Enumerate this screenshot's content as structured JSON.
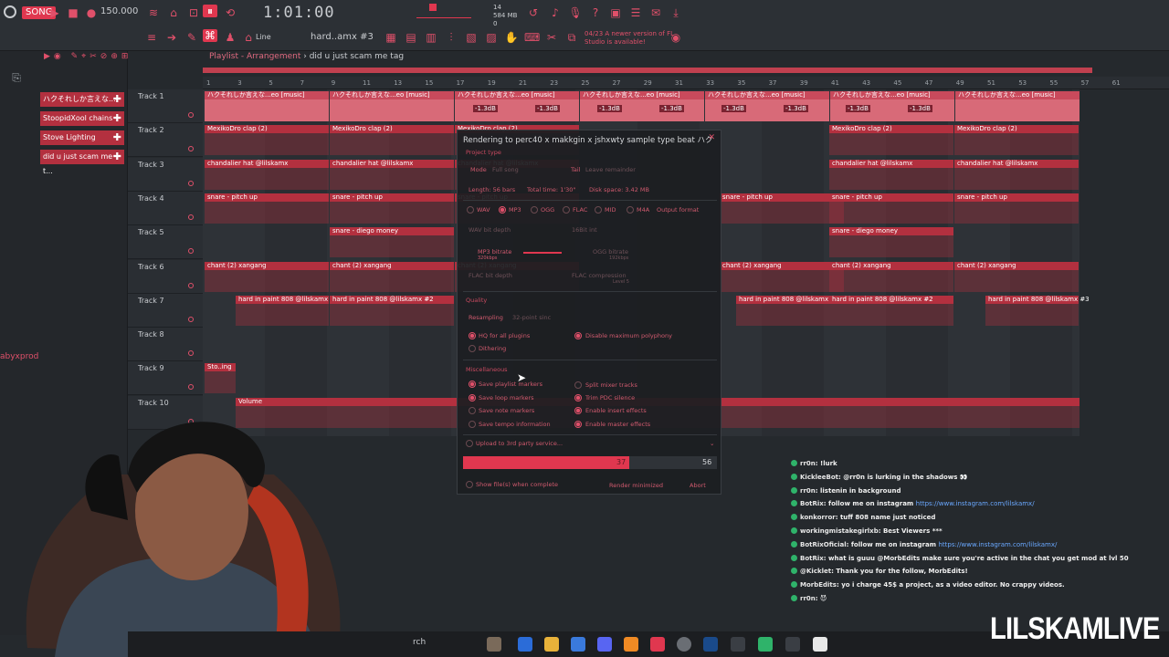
{
  "toolbar": {
    "song_mode": "SONG",
    "tempo": "150.000",
    "time": "1:01:00",
    "cpu_mem": [
      "14",
      "584 MB",
      "0"
    ],
    "pattern_name": "hard..amx #3",
    "snap_mode": "Line",
    "news": "04/23 A newer version of FL Studio is available!"
  },
  "browser": {
    "patterns": [
      "ハクそれしか言えな...",
      "StoopidXool chains",
      "Stove Lighting",
      "did u just scam me t..."
    ],
    "side_label": "abyxprod"
  },
  "playlist": {
    "title": "Playlist - Arrangement",
    "arrangement": "did u just scam me tag",
    "ruler": [
      "1",
      "3",
      "5",
      "7",
      "9",
      "11",
      "13",
      "15",
      "17",
      "19",
      "21",
      "23",
      "25",
      "27",
      "29",
      "31",
      "33",
      "35",
      "37",
      "39",
      "41",
      "43",
      "45",
      "47",
      "49",
      "51",
      "53",
      "55",
      "57",
      "61"
    ],
    "tracks": [
      "Track 1",
      "Track 2",
      "Track 3",
      "Track 4",
      "Track 5",
      "Track 6",
      "Track 7",
      "Track 8",
      "Track 9",
      "Track 10"
    ],
    "clip_labels": {
      "t1": "ハクそれしか言えな...eo [music]",
      "t1_db": "-1.3dB",
      "t2": "MexikoDro clap (2)",
      "t3": "chandalier hat @lilskamx",
      "t4": "snare - pitch up",
      "t5": "snare - diego money",
      "t6": "chant (2) xangang",
      "t7a": "hard in paint 808 @lilskamx",
      "t7b": "hard in paint 808 @lilskamx #2",
      "t7c": "hard in paint 808 @lilskamx #3",
      "t9": "Sto..ing",
      "t10": "Volume"
    }
  },
  "render": {
    "title": "Rendering to perc40 x makkgin x jshxwty sample type beat ハク",
    "project_type": "Project type",
    "mode_label": "Mode",
    "mode_value": "Full song",
    "tail_label": "Tail",
    "tail_value": "Leave remainder",
    "length": "Length: 56 bars",
    "total_time": "Total time: 1'30\"",
    "disk_space": "Disk space: 3.42 MB",
    "formats": [
      "WAV",
      "MP3",
      "OGG",
      "FLAC",
      "MID",
      "M4A"
    ],
    "selected_format": "MP3",
    "output_format": "Output format",
    "wav_bit_depth": "WAV bit depth",
    "wav_depth_value": "16Bit int",
    "mp3_bitrate": "MP3 bitrate",
    "mp3_bitrate_value": "320kbps",
    "ogg_bitrate": "OGG bitrate",
    "ogg_bitrate_value": "192kbps",
    "flac_bit_depth": "FLAC bit depth",
    "flac_compression": "FLAC compression",
    "flac_compression_value": "Level 5",
    "quality": "Quality",
    "resampling_label": "Resampling",
    "resampling_value": "32-point sinc",
    "hq_plugins": "HQ for all plugins",
    "disable_poly": "Disable maximum polyphony",
    "dithering": "Dithering",
    "misc": "Miscellaneous",
    "save_playlist": "Save playlist markers",
    "split_mixer": "Split mixer tracks",
    "save_loop": "Save loop markers",
    "trim_pdc": "Trim PDC silence",
    "save_note": "Save note markers",
    "enable_insert": "Enable insert effects",
    "save_tempo": "Save tempo information",
    "enable_master": "Enable master effects",
    "upload": "Upload to 3rd party service...",
    "progress_value": "37",
    "progress_max": "56",
    "progress_fraction": 0.655,
    "show_files": "Show file(s) when complete",
    "render_minimized": "Render minimized",
    "abort": "Abort"
  },
  "chat": [
    {
      "user": "rr0n",
      "text": ": !lurk"
    },
    {
      "user": "KickleeBot",
      "text": ": @rr0n is lurking in the shadows 👀"
    },
    {
      "user": "rr0n",
      "text": ": listenin in background"
    },
    {
      "user": "BotRix",
      "text": ": follow me on instagram ",
      "link": "https://www.instagram.com/lilskamx/"
    },
    {
      "user": "konkorror",
      "text": ": tuff 808 name just noticed"
    },
    {
      "user": "workingmistakegirlxb",
      "text": ": Best Viewers ***"
    },
    {
      "user": "BotRixOficial",
      "text": ": follow me on instagram ",
      "link": "https://www.instagram.com/lilskamx/"
    },
    {
      "user": "BotRix",
      "text": ": what is guuu @MorbEdits make sure you're active in the chat you get mod at lvl 50"
    },
    {
      "user": "@Kicklet",
      "text": ": Thank you for the follow, MorbEdits!"
    },
    {
      "user": "MorbEdits",
      "text": ": yo i charge 45$ a project, as a video editor. No crappy videos."
    },
    {
      "user": "rr0n",
      "text": ": 😈"
    }
  ],
  "brand": "LILSKAMLIVE",
  "taskbar": {
    "search_fragment": "rch"
  },
  "colors": {
    "accent": "#e0374f",
    "clip": "#b3303f",
    "bg": "#25292d"
  }
}
